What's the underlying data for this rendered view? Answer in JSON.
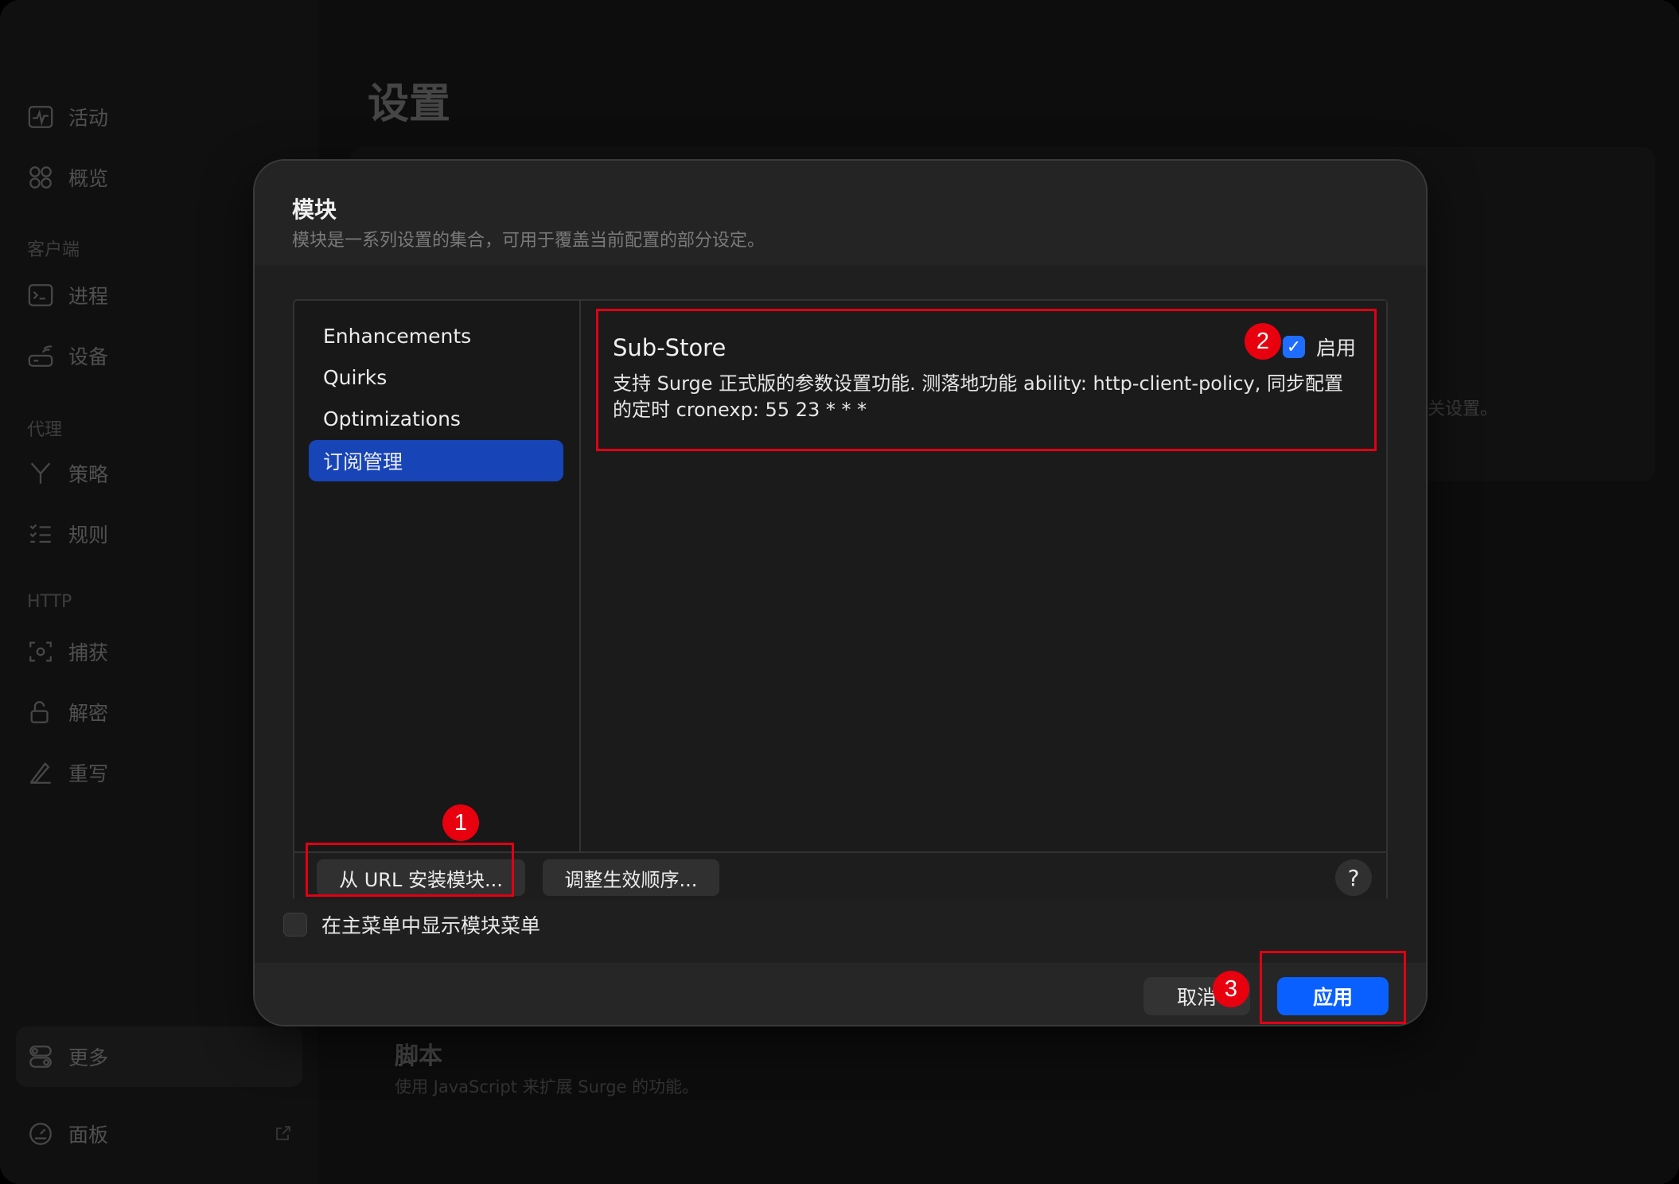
{
  "window": {
    "traffic_lights": [
      "close",
      "minimize",
      "maximize"
    ]
  },
  "sidebar": {
    "items_top": [
      {
        "label": "活动",
        "icon": "activity-icon"
      },
      {
        "label": "概览",
        "icon": "overview-grid-icon"
      }
    ],
    "section_client": "客户端",
    "items_client": [
      {
        "label": "进程",
        "icon": "process-terminal-icon"
      },
      {
        "label": "设备",
        "icon": "device-router-icon"
      }
    ],
    "section_proxy": "代理",
    "items_proxy": [
      {
        "label": "策略",
        "icon": "policy-branch-icon"
      },
      {
        "label": "规则",
        "icon": "rules-list-icon"
      }
    ],
    "section_http": "HTTP",
    "items_http": [
      {
        "label": "捕获",
        "icon": "capture-icon"
      },
      {
        "label": "解密",
        "icon": "decrypt-lock-icon"
      },
      {
        "label": "重写",
        "icon": "rewrite-pen-icon"
      }
    ],
    "more_label": "更多",
    "panel_label": "面板"
  },
  "main": {
    "title": "设置",
    "side_hint": "关设置。",
    "script_title": "脚本",
    "script_subtitle": "使用 JavaScript 来扩展 Surge 的功能。"
  },
  "dialog": {
    "title": "模块",
    "subtitle": "模块是一系列设置的集合，可用于覆盖当前配置的部分设定。",
    "modules": [
      {
        "label": "Enhancements",
        "selected": false
      },
      {
        "label": "Quirks",
        "selected": false
      },
      {
        "label": "Optimizations",
        "selected": false
      },
      {
        "label": "订阅管理",
        "selected": true
      }
    ],
    "detail": {
      "name": "Sub-Store",
      "description": "支持 Surge 正式版的参数设置功能. 测落地功能 ability: http-client-policy, 同步配置的定时 cronexp: 55 23 * * *",
      "enable_label": "启用",
      "enabled": true
    },
    "toolbar": {
      "install_label": "从 URL 安装模块...",
      "reorder_label": "调整生效顺序...",
      "help_label": "?"
    },
    "show_menu_label": "在主菜单中显示模块菜单",
    "show_menu_checked": false,
    "cancel_label": "取消",
    "apply_label": "应用"
  },
  "annotations": {
    "badge_1": "1",
    "badge_2": "2",
    "badge_3": "3",
    "color": "#e00014"
  }
}
